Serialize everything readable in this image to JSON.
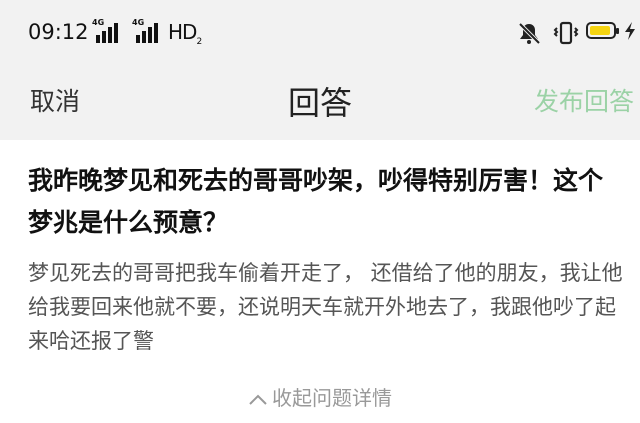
{
  "status_bar": {
    "time": "09:12",
    "signal_1_label": "4G",
    "signal_2_label": "4G",
    "hd_label": "HD",
    "hd_sub": "2",
    "battery_level": 0.85,
    "battery_color": "#f5d410"
  },
  "nav": {
    "cancel_label": "取消",
    "title": "回答",
    "publish_label": "发布回答",
    "publish_color": "#9bd2a6"
  },
  "question": {
    "title": "我昨晚梦见和死去的哥哥吵架，吵得特别厉害！这个梦兆是什么预意？",
    "detail": "梦见死去的哥哥把我车偷着开走了， 还借给了他的朋友，我让他给我要回来他就不要，还说明天车就开外地去了，我跟他吵了起来哈还报了警",
    "collapse_label": "收起问题详情"
  },
  "icons": [
    "mute-bell-icon",
    "vibrate-icon",
    "battery-icon",
    "charging-icon",
    "chevron-up-icon"
  ]
}
